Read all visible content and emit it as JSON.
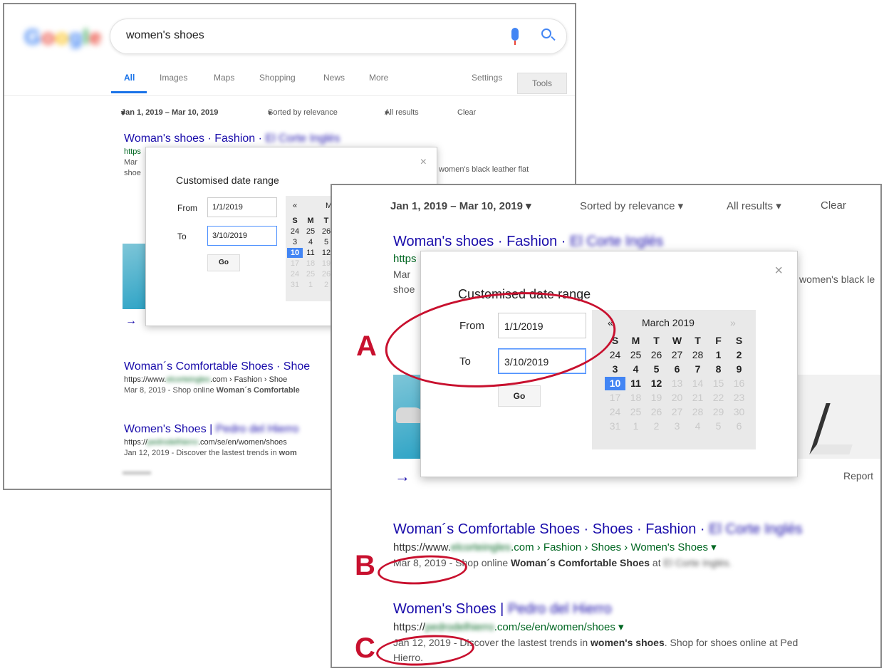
{
  "search": {
    "query": "women's shoes",
    "logo_text": "Google"
  },
  "tabs": [
    "All",
    "Images",
    "Maps",
    "Shopping",
    "News",
    "More",
    "Settings",
    "Tools"
  ],
  "filters": {
    "date_range": "Jan 1, 2019 – Mar 10, 2019",
    "sort": "Sorted by relevance",
    "results": "All results",
    "clear": "Clear"
  },
  "dialog": {
    "title": "Customised date range",
    "from_label": "From",
    "from_value": "1/1/2019",
    "to_label": "To",
    "to_value": "3/10/2019",
    "go": "Go",
    "close": "×"
  },
  "calendar": {
    "prev": "«",
    "month": "March 2019",
    "next": "»",
    "weekdays": [
      "S",
      "M",
      "T",
      "W",
      "T",
      "F",
      "S"
    ]
  },
  "results": [
    {
      "title": "Woman's shoes · Fashion · ",
      "title_blurred": "El Corte Inglés",
      "url_prefix": "https",
      "snippet_start": "Mar",
      "snippet_cont": "shoe",
      "snippet_right": "women's black leather flat",
      "snippet_right_big": "women's black le",
      "snippet_right_small": "women's black leather flat shoes"
    },
    {
      "title": "Woman´s Comfortable Shoes · Shoes · Fashion · ",
      "title_blurred": "El Corte Inglés",
      "url_start": "https://www.",
      "url_blurred": "elcorteingles",
      "url_end": ".com › Fashion › Shoes › Women's Shoes",
      "date": "Mar 8, 2019",
      "snippet_pre": " - Shop online ",
      "snippet_bold": "Woman´s Comfortable Shoes",
      "snippet_post": " at ",
      "snippet_blurred": "El Corte Inglés."
    },
    {
      "title": "Women's Shoes | ",
      "title_blurred": "Pedro del Hierro",
      "url_start": "https://",
      "url_blurred": "pedrodelhierro",
      "url_end": ".com/se/en/women/shoes",
      "date": "Jan 12, 2019",
      "snippet_pre": " - Discover the lastest trends in ",
      "snippet_bold": "women's shoes",
      "snippet_post": ". Shop for shoes online at Ped",
      "snippet_line2": "Hierro."
    }
  ],
  "small_results": {
    "r2_title": "Woman´s Comfortable Shoes · Shoe",
    "r2_url": ".com › Fashion › Shoe",
    "r2_snippet": "Mar 8, 2019 - Shop online ",
    "r2_snippet_bold": "Woman´s Comfortable",
    "r3_title": "Women's Shoes | ",
    "r3_url": ".com/se/en/women/shoes",
    "r3_snippet": "Jan 12, 2019 - Discover the lastest trends in ",
    "r3_snippet_bold": "wom"
  },
  "misc": {
    "arrow": "→",
    "report": "Report"
  },
  "annotations": [
    "A",
    "B",
    "C"
  ],
  "colors": {
    "link": "#1a0dab",
    "url": "#006621",
    "accent": "#4285f4",
    "annotation": "#c8102e"
  }
}
